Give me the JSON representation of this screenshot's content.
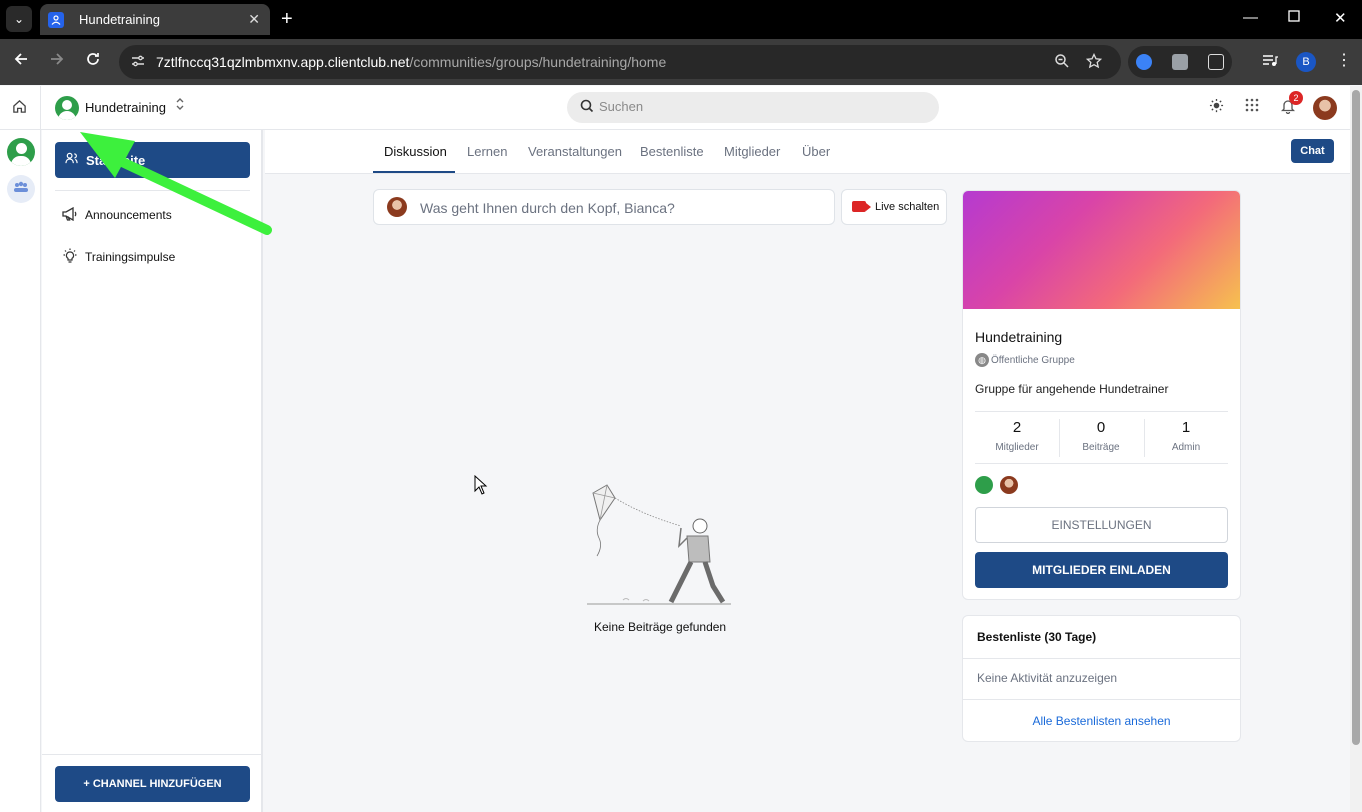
{
  "browser": {
    "tab_title": "Hundetraining",
    "tab_close": "✕",
    "new_tab": "+",
    "url_host": "7ztlfnccq31qzlmbmxnv.app.clientclub.net",
    "url_path": "/communities/groups/hundetraining/home",
    "profile_initial": "B"
  },
  "header": {
    "group_name": "Hundetraining",
    "search_placeholder": "Suchen",
    "notification_count": "2"
  },
  "sidebar": {
    "start_label": "Startseite",
    "channels": [
      {
        "label": "Announcements",
        "icon": "megaphone-icon"
      },
      {
        "label": "Trainingsimpulse",
        "icon": "lightbulb-icon"
      }
    ],
    "add_channel_label": "+ CHANNEL HINZUFÜGEN"
  },
  "tabs": [
    {
      "label": "Diskussion",
      "active": true
    },
    {
      "label": "Lernen"
    },
    {
      "label": "Veranstaltungen"
    },
    {
      "label": "Bestenliste"
    },
    {
      "label": "Mitglieder"
    },
    {
      "label": "Über"
    }
  ],
  "chat_label": "Chat",
  "composer": {
    "placeholder": "Was geht Ihnen durch den Kopf, Bianca?",
    "live_label": "Live schalten"
  },
  "feed": {
    "empty_text": "Keine Beiträge gefunden"
  },
  "group_card": {
    "name": "Hundetraining",
    "privacy": "Öffentliche Gruppe",
    "description": "Gruppe für angehende Hundetrainer",
    "stats": [
      {
        "value": "2",
        "label": "Mitglieder"
      },
      {
        "value": "0",
        "label": "Beiträge"
      },
      {
        "value": "1",
        "label": "Admin"
      }
    ],
    "settings_label": "EINSTELLUNGEN",
    "invite_label": "MITGLIEDER EINLADEN"
  },
  "leaderboard": {
    "title": "Bestenliste (30 Tage)",
    "empty_text": "Keine Aktivität anzuzeigen",
    "link_label": "Alle Bestenlisten ansehen"
  },
  "colors": {
    "primary": "#1e4a86",
    "group_avatar": "#2e9e4a",
    "annotation_arrow": "#3df03d",
    "notification_badge": "#dc2626",
    "link": "#1a6ad9"
  }
}
